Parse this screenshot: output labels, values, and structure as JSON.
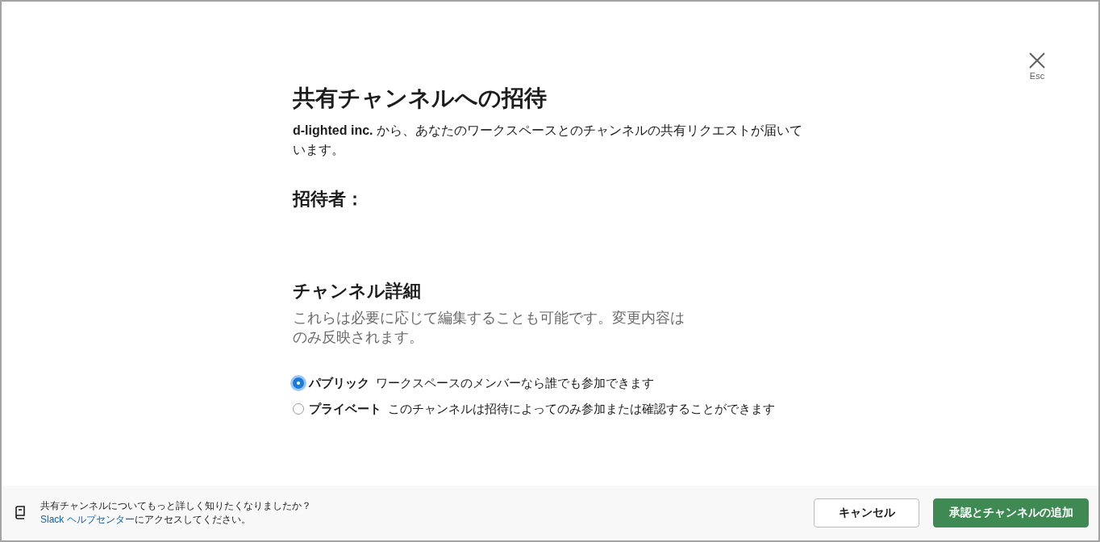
{
  "dialog": {
    "close": {
      "label": "Esc"
    },
    "title": "共有チャンネルへの招待",
    "intro": "**d-lighted inc.** から、あなたのワークスペースとのチャンネルの共有リクエストが届いています。",
    "inviter_heading": "招待者：",
    "details_heading": "チャンネル詳細",
    "details_note": "これらは必要に応じて編集することも可能です。変更内容はのみ反映されます。",
    "visibility_options": [
      {
        "label": "パブリック",
        "description": "ワークスペースのメンバーなら誰でも参加できます",
        "selected": true
      },
      {
        "label": "プライベート",
        "description": "このチャンネルは招待によってのみ参加または確認することができます",
        "selected": false
      }
    ]
  },
  "footer": {
    "help_question": "共有チャンネルについてもっと詳しく知りたくなりましたか？",
    "help_link": "Slack ヘルプセンター",
    "help_suffix": "にアクセスしてください。",
    "buttons": [
      {
        "label": "キャンセル",
        "kind": "secondary"
      },
      {
        "label": "承認とチャンネルの追加",
        "kind": "primary"
      }
    ]
  }
}
